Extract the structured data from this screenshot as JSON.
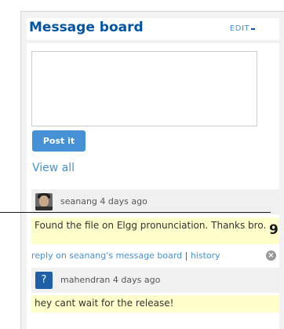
{
  "widget": {
    "title": "Message board",
    "edit_label": "EDIT",
    "collapse_icon": "minus-icon",
    "compose": {
      "textarea_value": "",
      "post_button_label": "Post it"
    },
    "view_all_label": "View all"
  },
  "messages": [
    {
      "author": "seanang",
      "time": "4 days ago",
      "avatar": "user-photo-avatar",
      "body": "Found the file on Elgg pronunciation. Thanks bro.",
      "reply_label": "reply on seanang's message board",
      "separator": " | ",
      "history_label": "history",
      "delete_icon": "delete-icon"
    },
    {
      "author": "mahendran",
      "time": "4 days ago",
      "avatar_glyph": "?",
      "body": "hey cant wait for the release!"
    }
  ],
  "overlay": {
    "partial_text": "9"
  },
  "colors": {
    "accent": "#4690d6",
    "title": "#0054a7",
    "message_highlight": "#ffffcc",
    "frame": "#f2f2f2"
  }
}
